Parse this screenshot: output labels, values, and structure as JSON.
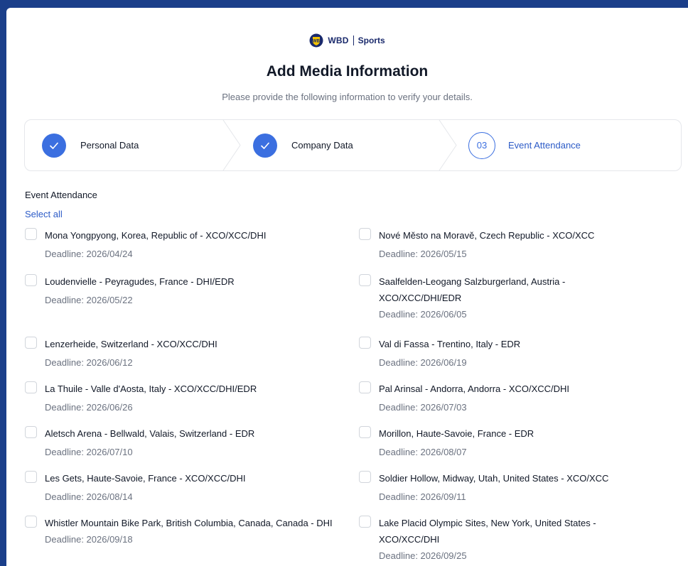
{
  "brand": {
    "wbd": "WBD",
    "sports": "Sports"
  },
  "header": {
    "title": "Add Media Information",
    "subtitle": "Please provide the following information to verify your details."
  },
  "steps": [
    {
      "label": "Personal Data",
      "status": "complete"
    },
    {
      "label": "Company Data",
      "status": "complete"
    },
    {
      "number": "03",
      "label": "Event Attendance",
      "status": "active"
    }
  ],
  "section": {
    "label": "Event Attendance",
    "select_all": "Select all"
  },
  "events": [
    {
      "name": "Mona Yongpyong, Korea, Republic of - XCO/XCC/DHI",
      "deadline": "Deadline: 2026/04/24"
    },
    {
      "name": "Nové Město na Moravě, Czech Republic - XCO/XCC",
      "deadline": "Deadline: 2026/05/15"
    },
    {
      "name": "Loudenvielle - Peyragudes, France - DHI/EDR",
      "deadline": "Deadline: 2026/05/22"
    },
    {
      "name": "Saalfelden-Leogang Salzburgerland, Austria - XCO/XCC/DHI/EDR",
      "deadline": "Deadline: 2026/06/05"
    },
    {
      "name": "Lenzerheide, Switzerland - XCO/XCC/DHI",
      "deadline": "Deadline: 2026/06/12"
    },
    {
      "name": "Val di Fassa - Trentino, Italy - EDR",
      "deadline": "Deadline: 2026/06/19"
    },
    {
      "name": "La Thuile - Valle d'Aosta, Italy - XCO/XCC/DHI/EDR",
      "deadline": "Deadline: 2026/06/26"
    },
    {
      "name": "Pal Arinsal - Andorra, Andorra - XCO/XCC/DHI",
      "deadline": "Deadline: 2026/07/03"
    },
    {
      "name": "Aletsch Arena - Bellwald, Valais, Switzerland - EDR",
      "deadline": "Deadline: 2026/07/10"
    },
    {
      "name": "Morillon, Haute-Savoie, France - EDR",
      "deadline": "Deadline: 2026/08/07"
    },
    {
      "name": "Les Gets, Haute-Savoie, France - XCO/XCC/DHI",
      "deadline": "Deadline: 2026/08/14"
    },
    {
      "name": "Soldier Hollow, Midway, Utah, United States - XCO/XCC",
      "deadline": "Deadline: 2026/09/11"
    },
    {
      "name": "Whistler Mountain Bike Park, British Columbia, Canada, Canada - DHI",
      "deadline": "Deadline: 2026/09/18"
    },
    {
      "name": "Lake Placid Olympic Sites, New York, United States - XCO/XCC/DHI",
      "deadline": "Deadline: 2026/09/25"
    }
  ],
  "colors": {
    "accent": "#3b6fe0",
    "link": "#2c5bc7",
    "background": "#1b3f8a"
  }
}
